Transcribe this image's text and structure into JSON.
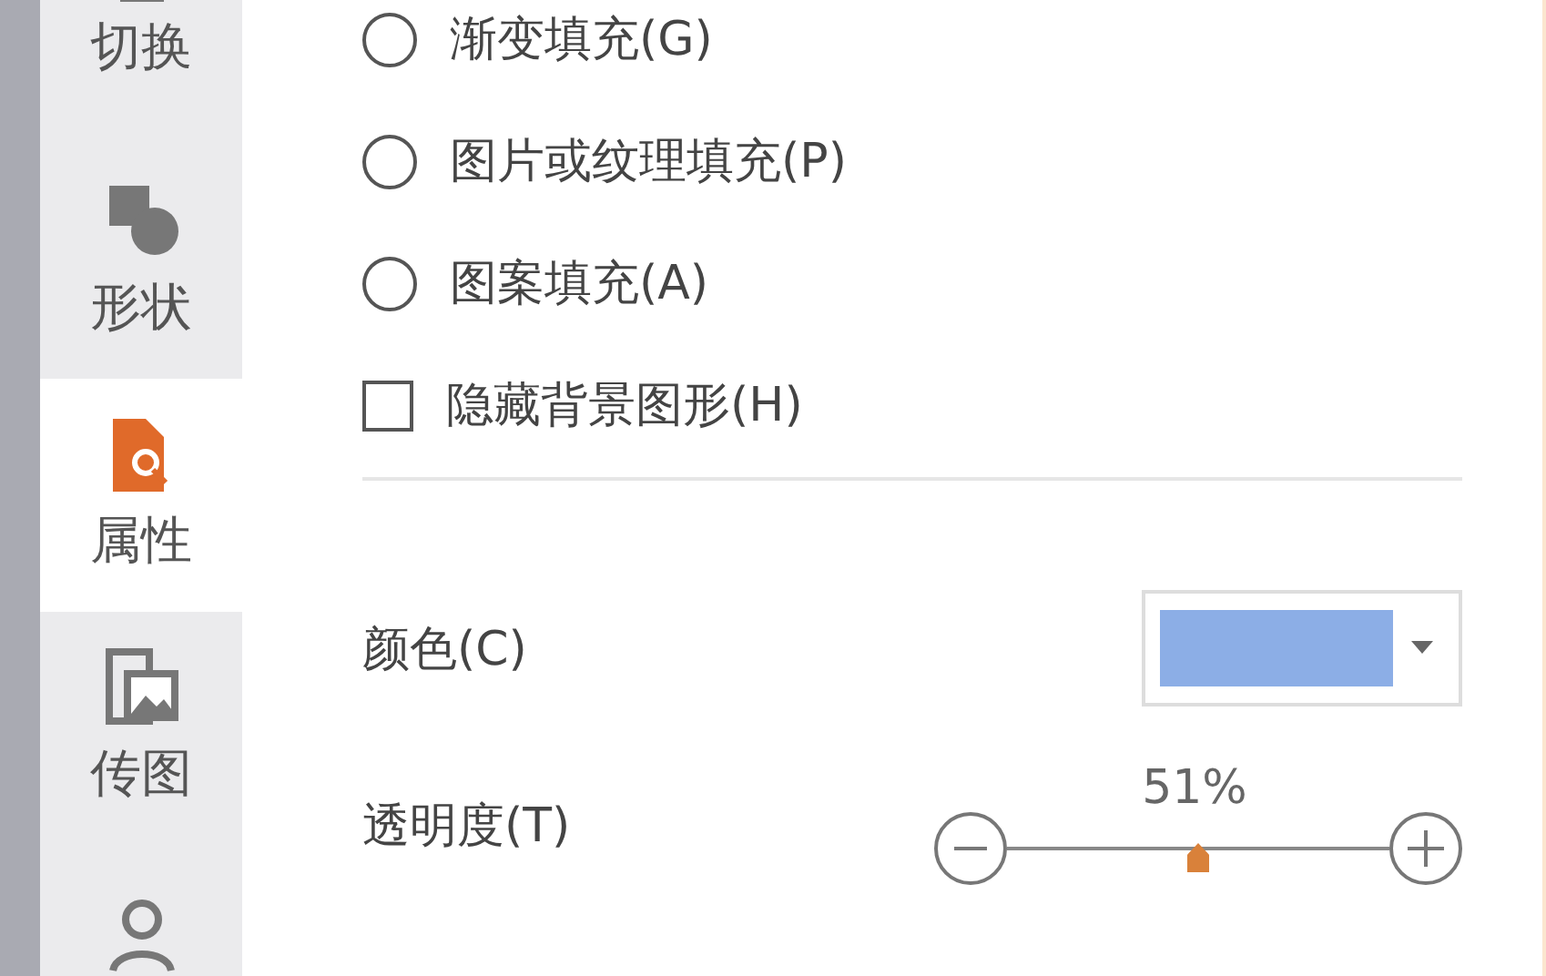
{
  "sidebar": {
    "items": [
      {
        "label": "切换",
        "kind": "transition",
        "selected": false
      },
      {
        "label": "形状",
        "kind": "shape",
        "selected": false
      },
      {
        "label": "属性",
        "kind": "properties",
        "selected": true
      },
      {
        "label": "传图",
        "kind": "upload",
        "selected": false
      },
      {
        "kind": "person",
        "selected": false
      }
    ]
  },
  "fill_options": [
    {
      "kind": "radio",
      "label": "渐变填充(G)",
      "selected": false
    },
    {
      "kind": "radio",
      "label": "图片或纹理填充(P)",
      "selected": false
    },
    {
      "kind": "radio",
      "label": "图案填充(A)",
      "selected": false
    },
    {
      "kind": "checkbox",
      "label": "隐藏背景图形(H)",
      "checked": false
    }
  ],
  "color": {
    "label": "颜色(C)",
    "color": "#8caee6"
  },
  "transparency": {
    "label": "透明度(T)",
    "reading": "51%",
    "level": 0.5
  }
}
